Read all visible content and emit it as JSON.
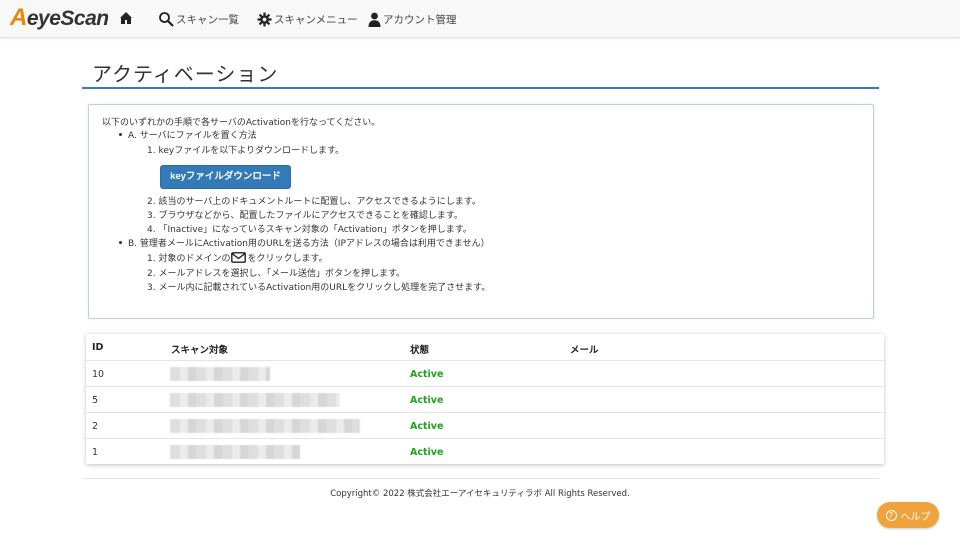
{
  "navbar": {
    "logo_first": "A",
    "logo_rest": "eyeScan",
    "items": [
      {
        "label": "スキャン一覧",
        "icon": "search-icon"
      },
      {
        "label": "スキャンメニュー",
        "icon": "gear-icon"
      },
      {
        "label": "アカウント管理",
        "icon": "user-icon"
      }
    ]
  },
  "page": {
    "title": "アクティベーション"
  },
  "instructions": {
    "intro": "以下のいずれかの手順で各サーバのActivationを行なってください。",
    "a_heading": "A. サーバにファイルを置く方法",
    "a1": "1. keyファイルを以下よりダウンロードします。",
    "download_button": "keyファイルダウンロード",
    "a2": "2. 該当のサーバ上のドキュメントルートに配置し、アクセスできるようにします。",
    "a3": "3. ブラウザなどから、配置したファイルにアクセスできることを確認します。",
    "a4": "4. 「Inactive」になっているスキャン対象の「Activation」ボタンを押します。",
    "b_heading": "B. 管理者メールにActivation用のURLを送る方法（IPアドレスの場合は利用できません）",
    "b1_pre": "1. 対象のドメインの",
    "b1_post": "をクリックします。",
    "b2": "2. メールアドレスを選択し、「メール送信」ボタンを押します。",
    "b3": "3. メール内に記載されているActivation用のURLをクリックし処理を完了させます。"
  },
  "table": {
    "headers": {
      "id": "ID",
      "target": "スキャン対象",
      "state": "状態",
      "mail": "メール"
    },
    "rows": [
      {
        "id": "10",
        "state": "Active"
      },
      {
        "id": "5",
        "state": "Active"
      },
      {
        "id": "2",
        "state": "Active"
      },
      {
        "id": "1",
        "state": "Active"
      }
    ]
  },
  "footer": {
    "copyright": "Copyright© 2022 株式会社エーアイセキュリティラボ All Rights Reserved."
  },
  "help": {
    "label": "ヘルプ"
  },
  "colors": {
    "accent": "#337ab7",
    "active": "#1aa51a",
    "help": "#f0a33c",
    "logo_orange": "#e8890c"
  }
}
